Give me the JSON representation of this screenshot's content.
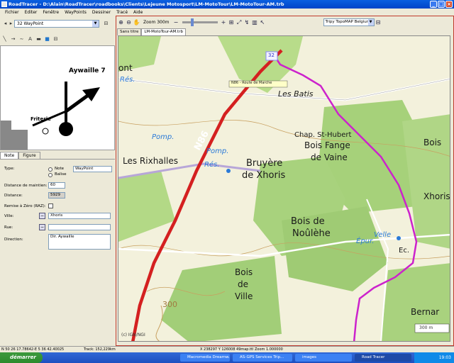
{
  "window": {
    "title": "RoadTracer - D:\\Alain\\RoadTracer\\roadbooks\\Clients\\Lejeune Motosport\\LM-MotoTour\\LM-MotoTour-AM.trb",
    "btn_min": "_",
    "btn_max": "□",
    "btn_close": "×"
  },
  "menu": [
    "Fichier",
    "Editer",
    "Fenêtre",
    "WayPoints",
    "Dessiner",
    "Tracé",
    "Aide"
  ],
  "left": {
    "waypoint_select": "32 WayPoint",
    "roadbook": {
      "direction_text": "Aywaille 7",
      "place_text": "Friterie"
    },
    "tabs": [
      "Note",
      "Figure"
    ],
    "form": {
      "type_label": "Type:",
      "radio_note": "Note",
      "radio_balise": "Balise",
      "type_select": "WayPoint",
      "distance_maintien_label": "Distance de maintien:",
      "distance_maintien_value": "60",
      "distance_label": "Distance:",
      "distance_value": "5929",
      "remise_label": "Remise à Zéro (RAZ):",
      "ville_label": "Ville:",
      "ville_value": "Xhoris",
      "rue_label": "Rue:",
      "rue_value": "",
      "direction_label": "Direction:",
      "direction_value": "Dir. Aywaille"
    }
  },
  "right": {
    "zoom_label": "Zoom 300m",
    "map_source": "Tripy TopoMAP Belgium",
    "doc_tabs": [
      "Sans titre",
      "LM-MotoTour-AM.trb"
    ],
    "map": {
      "labels": {
        "road": "N86",
        "batis": "Les Batis",
        "chapel": "Chap. St-Hubert",
        "bois_fange": "Bois Fange",
        "de_vaine": "de Vaine",
        "rixhalles": "Les Rixhalles",
        "bruyere": "Bruyère",
        "de_xhoris": "de Xhoris",
        "pomp1": "Pomp.",
        "pomp2": "Pomp.",
        "res1": "Rés.",
        "res2": "Rés.",
        "bois_noulehe": "Bois de",
        "noulehe": "Noûlèhe",
        "bois_ville": "Bois",
        "de_ville": "de",
        "ville": "Ville",
        "bois_right": "Bois",
        "xhoris_right": "Xhoris",
        "bernard": "Bernar",
        "ec": "Ec.",
        "epur": "Épur.",
        "velle": "Velle",
        "val300": "300",
        "copyright": "(c) IGN/NGI",
        "scale": "300 m",
        "waypoint_num": "32",
        "tooltip": "N86 - Route de Marche",
        "ont": "ont"
      }
    }
  },
  "status": {
    "coords": "N 50 26 17.78642-E 5 36 42.40025",
    "track": "Track: 152,229km",
    "xy": "X 238297 Y 126008 49map.ttl Zoom 1.000000"
  },
  "taskbar": {
    "start": "démarrer",
    "tasks": [
      "Macromedia Dreamw...",
      "AS-GPS Services Trip...",
      "images",
      "Road Tracer"
    ],
    "clock": "19:03"
  },
  "colors": {
    "route": "#cc22cc",
    "road": "#d42020",
    "forest": "#a6d17a",
    "accent": "#0a5fe0"
  }
}
